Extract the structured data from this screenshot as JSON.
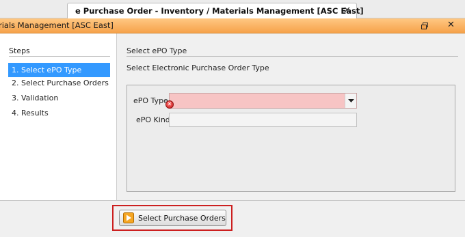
{
  "tab": {
    "title": "e Purchase Order  - Inventory / Materials Management [ASC East]",
    "close_glyph": "✕",
    "icon": "document-edit-icon"
  },
  "window": {
    "title": "rials Management [ASC East]",
    "restore_icon": "restore-window-icon",
    "close_glyph": "✕"
  },
  "steps": {
    "heading": "Steps",
    "items": [
      {
        "label": "1.  Select ePO Type",
        "active": true
      },
      {
        "label": "2.  Select Purchase Orders",
        "active": false
      },
      {
        "label": "3.  Validation",
        "active": false
      },
      {
        "label": "4.  Results",
        "active": false
      }
    ]
  },
  "content": {
    "title": "Select ePO Type",
    "description": "Select Electronic Purchase Order Type",
    "fields": {
      "epo_type": {
        "label": "ePO Type",
        "value": "",
        "error": true
      },
      "epo_kind": {
        "label": "ePO Kind",
        "value": ""
      }
    }
  },
  "footer": {
    "button_label": "Select Purchase Orders",
    "button_icon": "play-arrow-icon"
  },
  "colors": {
    "titlebar": "#f6a24a",
    "step_active": "#3399ff",
    "error_field": "#f7c4c4",
    "highlight": "#cc1f1f"
  }
}
